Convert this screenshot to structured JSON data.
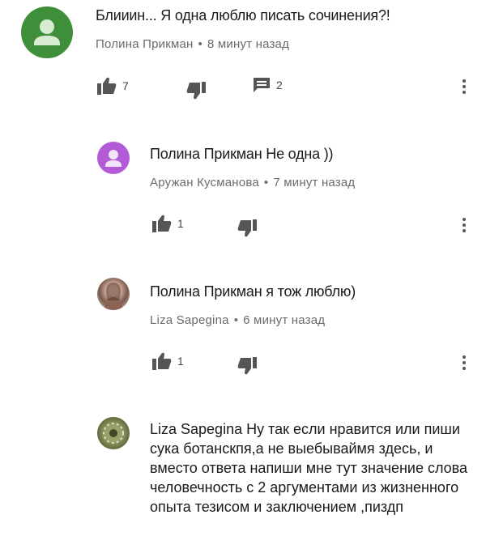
{
  "comments": [
    {
      "text": "Блииин... Я одна люблю писать сочинения?!",
      "author": "Полина Прикман",
      "time": "8 минут назад",
      "likes": "7",
      "replies": "2"
    },
    {
      "text": "Полина Прикман Не одна ))",
      "author": "Аружан Кусманова",
      "time": "7 минут назад",
      "likes": "1"
    },
    {
      "text": "Полина Прикман я тож люблю)",
      "author": "Liza Sapegina",
      "time": "6 минут назад",
      "likes": "1"
    },
    {
      "text": "Liza Sapegina Ну так если нравится или пиши сука ботанскпя,а не выебываймя здесь, и вместо ответа напиши мне тут значение слова человечность с 2 аргументами из жизненного опыта тезисом и заключением ,пиздп"
    }
  ],
  "separator": "•",
  "colors": {
    "avatar_green": "#3f8f3a",
    "avatar_purple": "#b35bd6"
  }
}
